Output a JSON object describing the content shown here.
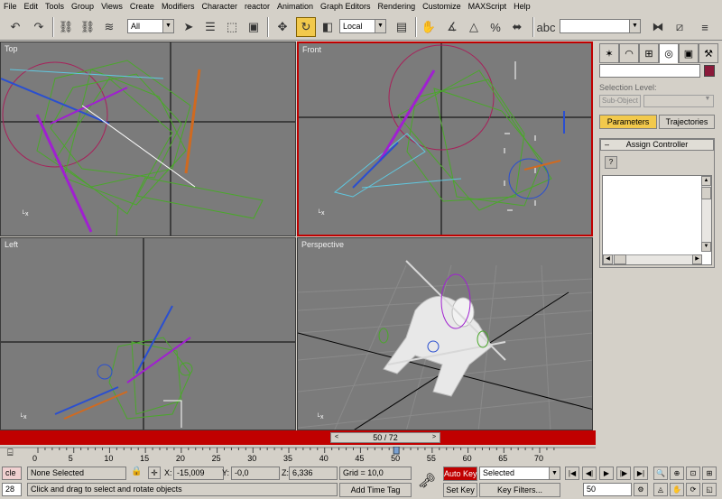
{
  "menu": [
    "File",
    "Edit",
    "Tools",
    "Group",
    "Views",
    "Create",
    "Modifiers",
    "Character",
    "reactor",
    "Animation",
    "Graph Editors",
    "Rendering",
    "Customize",
    "MAXScript",
    "Help"
  ],
  "toolbar": {
    "filter_value": "All",
    "coord_system": "Local",
    "named_selection": ""
  },
  "viewports": {
    "top": {
      "label": "Top"
    },
    "front": {
      "label": "Front"
    },
    "left": {
      "label": "Left"
    },
    "perspective": {
      "label": "Perspective"
    }
  },
  "command_panel": {
    "selection_level_label": "Selection Level:",
    "sub_object_label": "Sub-Object",
    "parameters_tab": "Parameters",
    "trajectories_tab": "Trajectories",
    "rollout_title": "Assign Controller",
    "rollout_toggle": "–",
    "help_icon": "?"
  },
  "timeline": {
    "frame_display": "50 / 72",
    "current_frame": 50,
    "total_frames": 72,
    "ticks": [
      "0",
      "5",
      "10",
      "15",
      "20",
      "25",
      "30",
      "35",
      "40",
      "45",
      "50",
      "55",
      "60",
      "65",
      "70"
    ]
  },
  "status": {
    "script_label": "cle",
    "script_number": "28",
    "selection": "None Selected",
    "x_label": "X:",
    "x_value": "-15,009",
    "y_label": "Y:",
    "y_value": "-0,0",
    "z_label": "Z:",
    "z_value": "6,336",
    "grid": "Grid = 10,0",
    "prompt": "Click and drag to select and rotate objects",
    "add_time_tag": "Add Time Tag",
    "auto_key": "Auto Key",
    "selected": "Selected",
    "set_key": "Set Key",
    "key_filters": "Key Filters...",
    "frame_field": "50"
  },
  "colors": {
    "viewport_bg": "#7b7b7b",
    "active_border": "#c00000",
    "highlight": "#f2c94c",
    "wire_green": "#4aa82a",
    "wire_purple": "#a020d0",
    "wire_blue": "#2a4fd0",
    "wire_orange": "#d06a20",
    "wire_cyan": "#60c8e0"
  }
}
